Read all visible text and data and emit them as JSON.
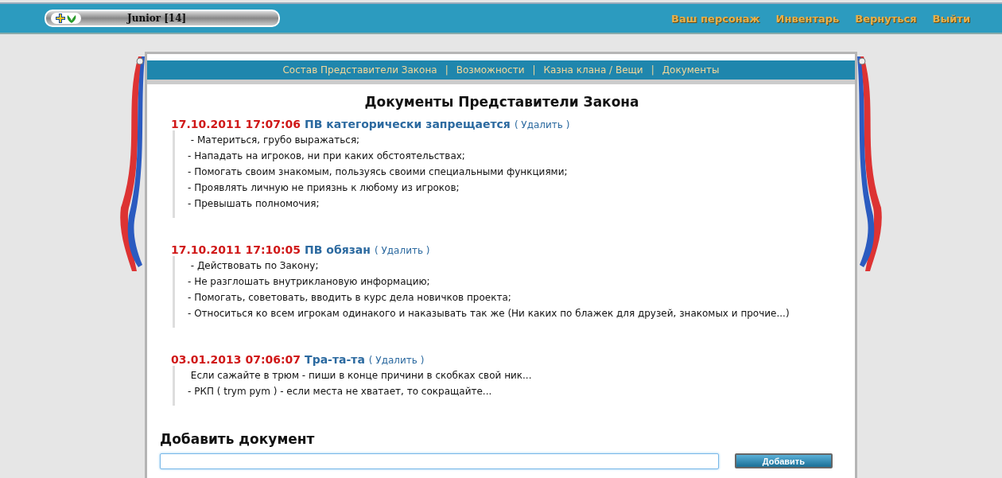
{
  "top_bar": {
    "player": "Junior [14]",
    "links": [
      "Ваш персонаж",
      "Инвентарь",
      "Вернуться",
      "Выйти"
    ]
  },
  "nav": {
    "items": [
      "Состав Представители Закона",
      "Возможности",
      "Казна клана / Вещи",
      "Документы"
    ],
    "separator": "|"
  },
  "title": "Документы Представители Закона",
  "documents": [
    {
      "date": "17.10.2011 17:07:06",
      "title": "ПВ категорически запрещается",
      "delete": "( Удалить )",
      "lines": [
        " - Материться, грубо выражаться;",
        "- Нападать на игроков, ни при каких обстоятельствах;",
        "- Помогать своим знакомым, пользуясь своими специальными функциями;",
        "- Проявлять личную не приязнь к любому из игроков;",
        "- Превышать полномочия;"
      ]
    },
    {
      "date": "17.10.2011 17:10:05",
      "title": "ПВ обязан",
      "delete": "( Удалить )",
      "lines": [
        " - Действовать по Закону;",
        "- Не разглошать внутриклановую информацию;",
        "- Помогать, советовать, вводить в курс дела новичков проекта;",
        "- Относиться ко всем игрокам одинакого и наказывать так же (Ни каких по блажек для друзей, знакомых и прочие...)"
      ]
    },
    {
      "date": "03.01.2013 07:06:07",
      "title": "Тра-та-та",
      "delete": "( Удалить )",
      "lines": [
        " Если сажайте в трюм - пиши в конце причини в скобках свой ник...",
        "- РКП ( trym pym ) - если места не хватает, то сокращайте..."
      ]
    }
  ],
  "add": {
    "heading": "Добавить документ",
    "button": "Добавить"
  }
}
